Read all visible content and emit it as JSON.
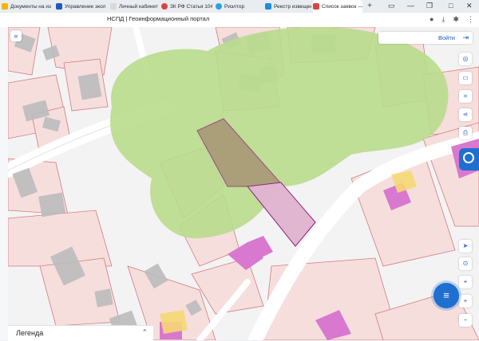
{
  "browser": {
    "tabs": [
      {
        "label": "Документы на из",
        "icon": "folder-icon",
        "color": "#f5b400"
      },
      {
        "label": "Управление экол",
        "icon": "brand-icon",
        "color": "#1e5bb8"
      },
      {
        "label": "Личный кабинет",
        "icon": "document-icon",
        "color": "#d9d9d9"
      },
      {
        "label": "ЗК РФ Статья 104",
        "icon": "brand-icon",
        "color": "#d64541"
      },
      {
        "label": "Риэлтор",
        "icon": "telegram-icon",
        "color": "#2aa3e0"
      },
      {
        "label": "Реестр извещени",
        "icon": "brand-icon",
        "color": "#1e8fd6"
      },
      {
        "label": "Список заявок —",
        "icon": "brand-icon",
        "color": "#d64541"
      }
    ],
    "new_tab": "+",
    "page_title": "НСПД | Геоинформационный портал"
  },
  "map": {
    "login_label": "Войти",
    "legend_label": "Легенда",
    "colors": {
      "forest": "#b9dc8c",
      "parcel_fill": "#f6dedd",
      "parcel_stroke": "#d47b7b",
      "building": "#bcbcbc",
      "selected": "#e6b8d8",
      "selected_stroke": "#8a1f7a",
      "accent": "#1e6fd0"
    },
    "tools": [
      "location-icon",
      "ruler-icon",
      "area-icon",
      "share-icon",
      "print-icon"
    ],
    "bottom_tools": [
      "navigate-icon",
      "my-location-icon",
      "zoom-in-icon",
      "zoom-out-icon"
    ]
  }
}
